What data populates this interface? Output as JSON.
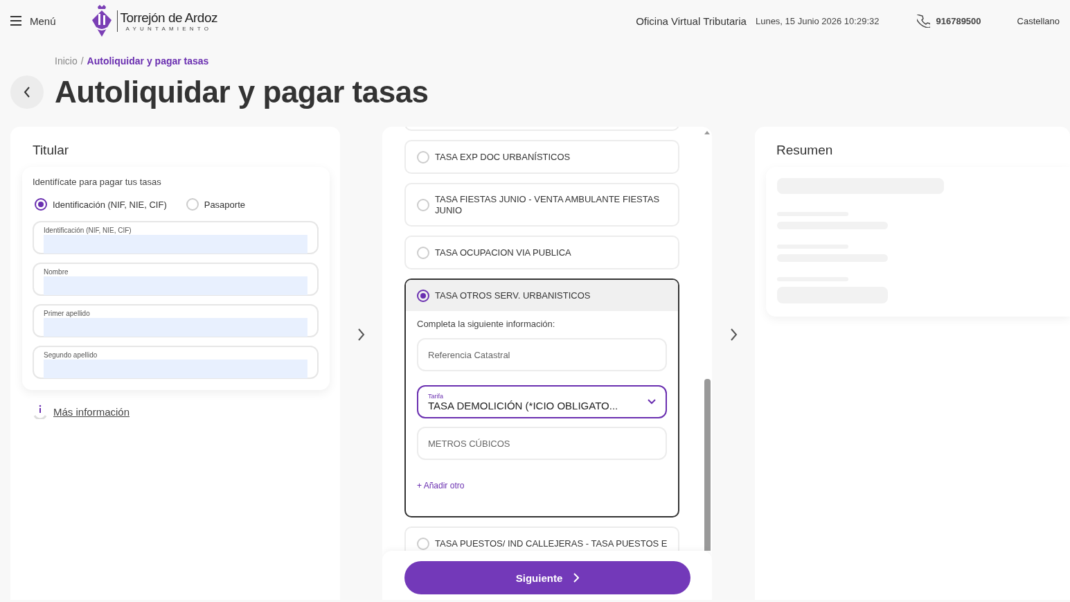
{
  "header": {
    "menu_label": "Menú",
    "logo": {
      "name": "Torrejón de Ardoz",
      "subtitle": "AYUNTAMIENTO"
    },
    "office": "Oficina Virtual Tributaria",
    "datetime": "Lunes, 15 Junio 2026 10:29:32",
    "phone": "916789500",
    "language": "Castellano"
  },
  "breadcrumb": [
    {
      "label": "Inicio",
      "current": false
    },
    {
      "separator": "/"
    },
    {
      "label": "Autoliquidar y pagar tasas",
      "current": true
    }
  ],
  "page_title": "Autoliquidar y pagar tasas",
  "titular": {
    "title": "Titular",
    "prompt": "Identifícate para pagar tus tasas",
    "id_types": [
      {
        "label": "Identificación (NIF, NIE, CIF)",
        "selected": true
      },
      {
        "label": "Pasaporte",
        "selected": false
      }
    ],
    "fields": [
      {
        "label": "Identificación (NIF, NIE, CIF)"
      },
      {
        "label": "Nombre"
      },
      {
        "label": "Primer apellido"
      },
      {
        "label": "Segundo apellido"
      }
    ],
    "more_info": "Más información"
  },
  "tasas": {
    "items": [
      {
        "label": "TASA EXP DOC URBANÍSTICOS",
        "selected": false
      },
      {
        "label": "TASA FIESTAS JUNIO - VENTA AMBULANTE FIESTAS JUNIO",
        "selected": false
      },
      {
        "label": "TASA OCUPACION VIA PUBLICA",
        "selected": false
      },
      {
        "label": "TASA OTROS SERV. URBANISTICOS",
        "selected": true,
        "details": {
          "prompt": "Completa la siguiente información:",
          "fields": [
            {
              "kind": "input",
              "placeholder": "Referencia Catastral"
            },
            {
              "kind": "select",
              "label": "Tarifa",
              "value": "TASA DEMOLICIÓN (*ICIO OBLIGATO..."
            },
            {
              "kind": "input",
              "placeholder": "METROS CÚBICOS"
            }
          ],
          "add_link": "+ Añadir otro"
        }
      },
      {
        "label": "TASA PUESTOS/ IND CALLEJERAS - TASA PUESTOS E",
        "selected": false
      }
    ],
    "next_button": "Siguiente"
  },
  "resumen": {
    "title": "Resumen"
  }
}
